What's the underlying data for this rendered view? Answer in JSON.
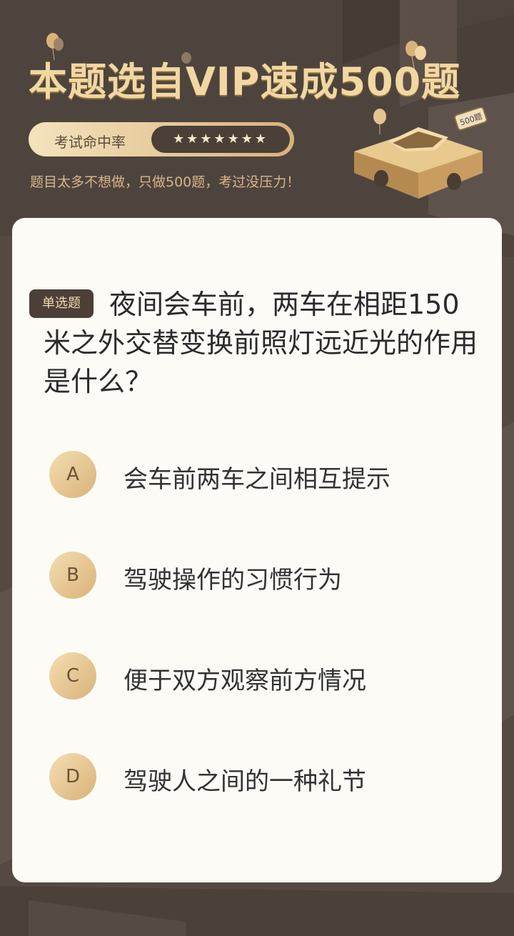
{
  "banner": {
    "title": "本题选自VIP速成500题",
    "rate_label": "考试命中率",
    "rate_stars": "★★★★★★★",
    "subtitle": "题目太多不想做，只做500题，考过没压力！",
    "car_badge": "500题"
  },
  "question": {
    "type_badge": "单选题",
    "text": "夜间会车前，两车在相距150米之外交替变换前照灯远近光的作用是什么？"
  },
  "options": [
    {
      "letter": "A",
      "text": "会车前两车之间相互提示"
    },
    {
      "letter": "B",
      "text": "驾驶操作的习惯行为"
    },
    {
      "letter": "C",
      "text": "便于双方观察前方情况"
    },
    {
      "letter": "D",
      "text": "驾驶人之间的一种礼节"
    }
  ],
  "colors": {
    "background": "#554a43",
    "accent_gold": "#d9b27a",
    "card": "#fdfbf5",
    "dark_badge": "#4b3f38"
  },
  "icons": {
    "car": "car-icon",
    "balloon": "balloon-icon"
  }
}
